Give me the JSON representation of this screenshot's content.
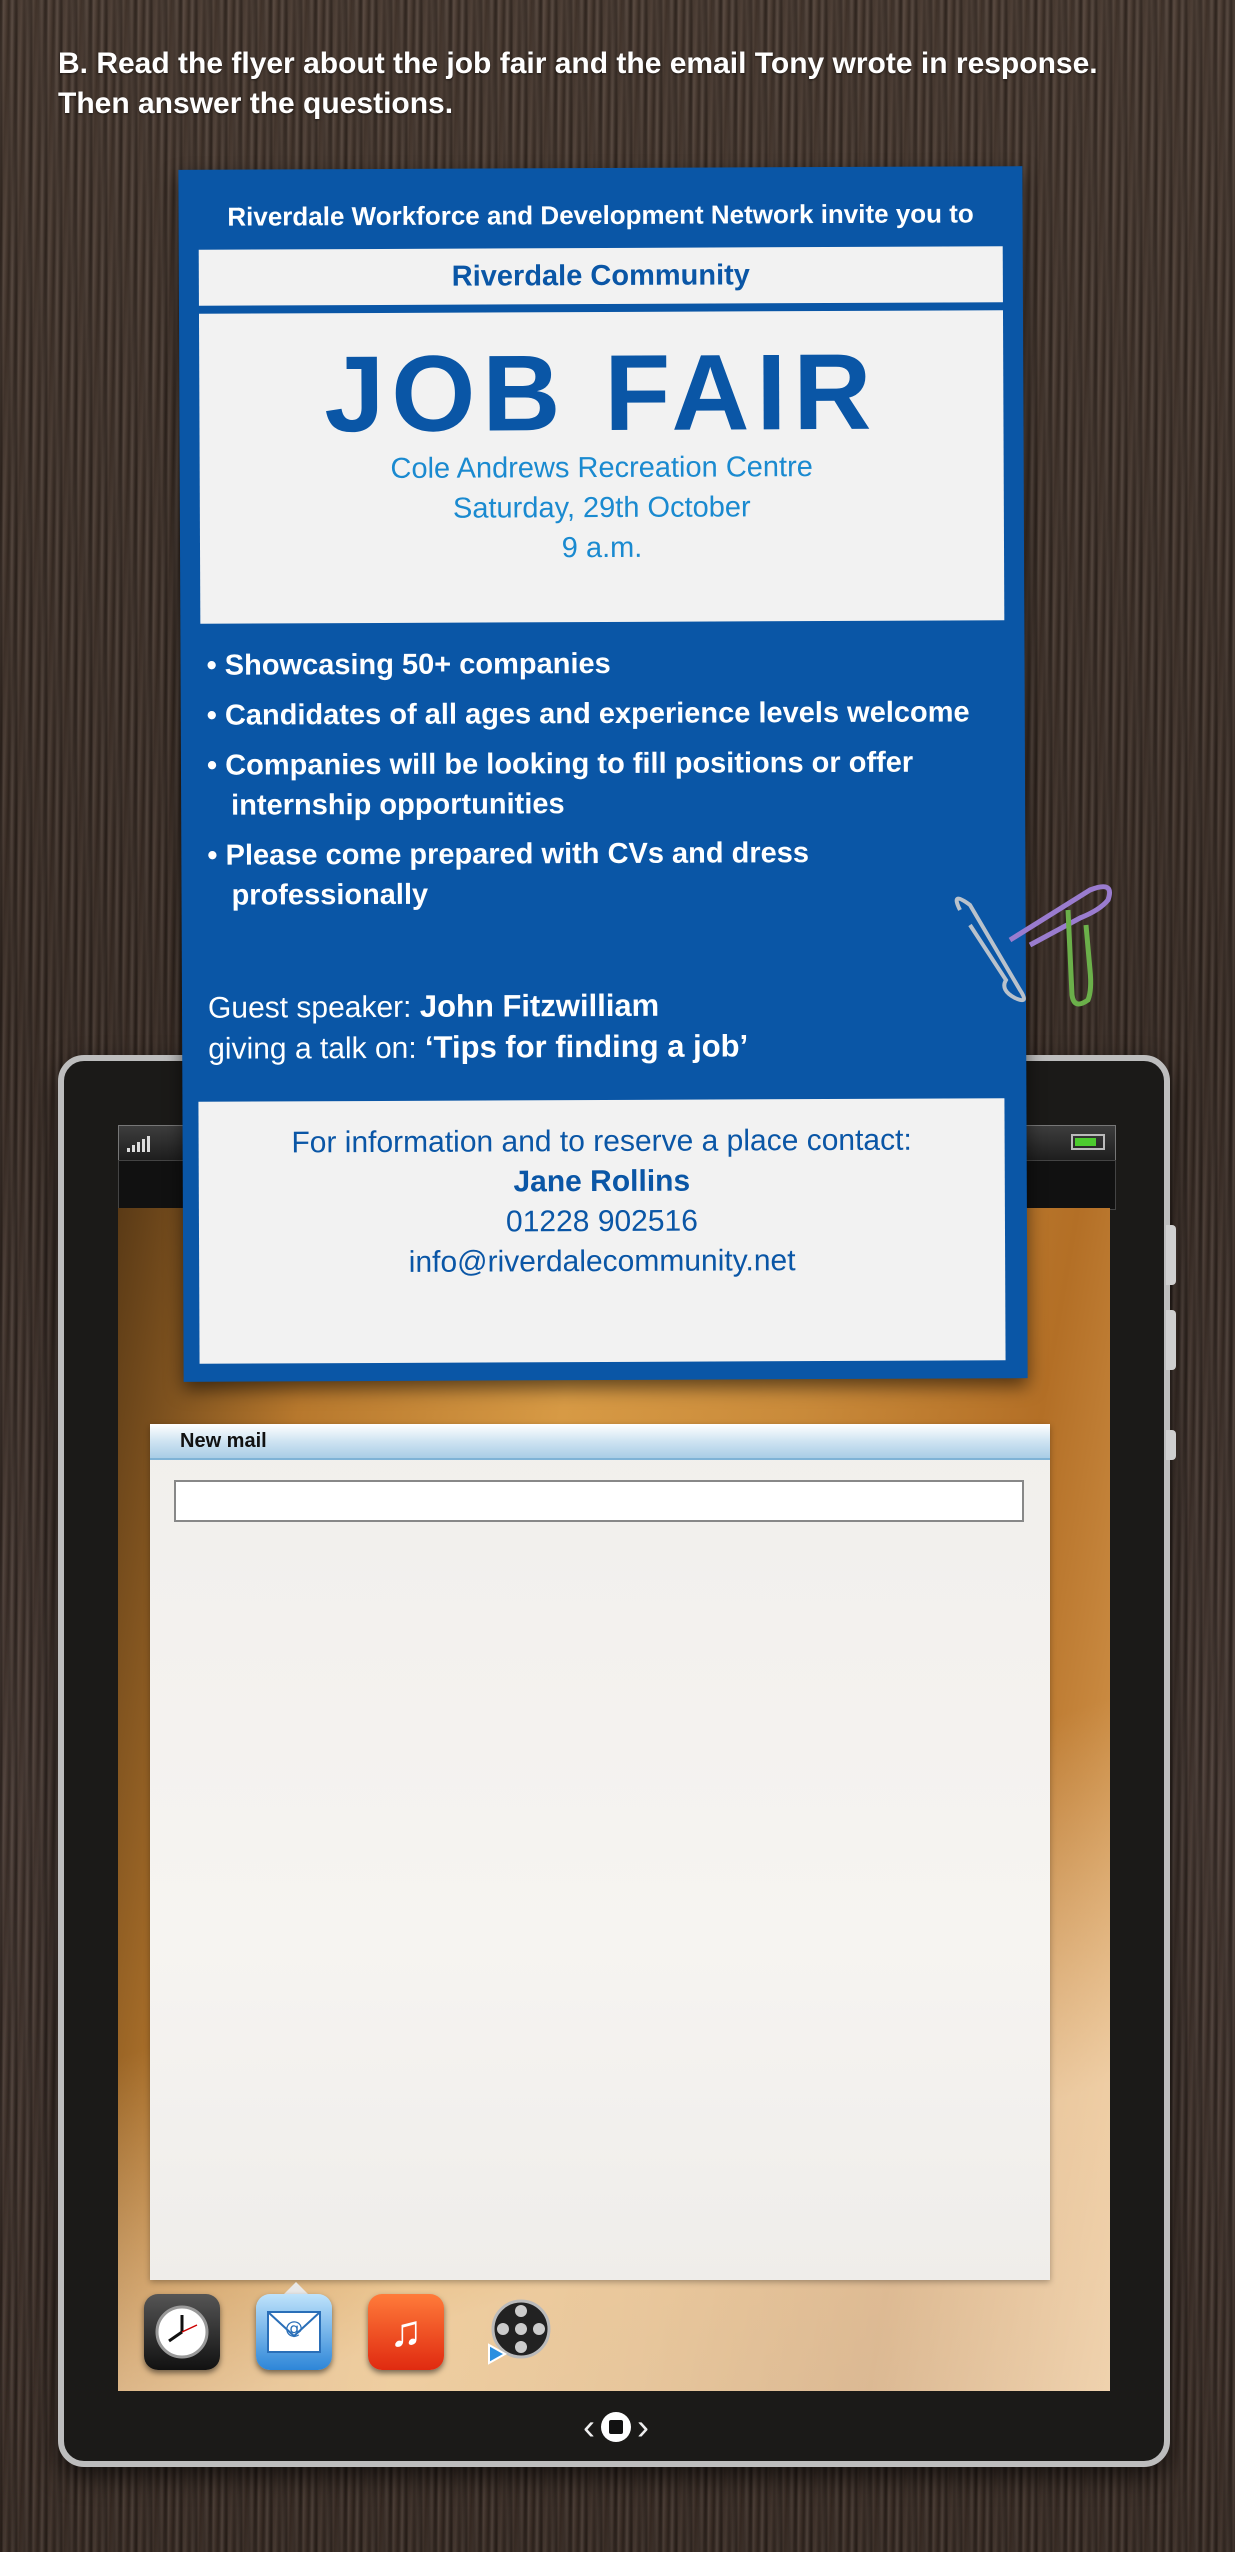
{
  "heading": "B. Read the flyer about the job fair and the email Tony wrote in response. Then answer the questions.",
  "flyer": {
    "top_line": "Riverdale Workforce and Development Network invite you to",
    "community": "Riverdale Community",
    "title": "JOB FAIR",
    "venue": "Cole Andrews Recreation Centre",
    "date": "Saturday, 29th October",
    "time": "9 a.m.",
    "bullets": [
      "• Showcasing 50+ companies",
      "• Candidates of all ages and experience levels welcome",
      "• Companies will be looking to fill positions or offer internship opportunities",
      "• Please come prepared with CVs and dress professionally"
    ],
    "speaker_label": "Guest speaker: ",
    "speaker_name": "John Fitzwilliam",
    "talk_label": "giving a talk on: ",
    "talk_title": "‘Tips for finding a job’",
    "contact_intro": "For information and to reserve a place contact:",
    "contact_name": "Jane Rollins",
    "contact_phone": "01228 902516",
    "contact_email": "info@riverdalecommunity.net"
  },
  "mail": {
    "header": "New mail",
    "subject_value": ""
  },
  "dock_icons": [
    "clock-icon",
    "mail-icon",
    "music-icon",
    "video-icon"
  ],
  "colors": {
    "flyer_blue": "#0a56a6",
    "accent_light_blue": "#1a8ad0",
    "battery_green": "#4ccb2e"
  }
}
